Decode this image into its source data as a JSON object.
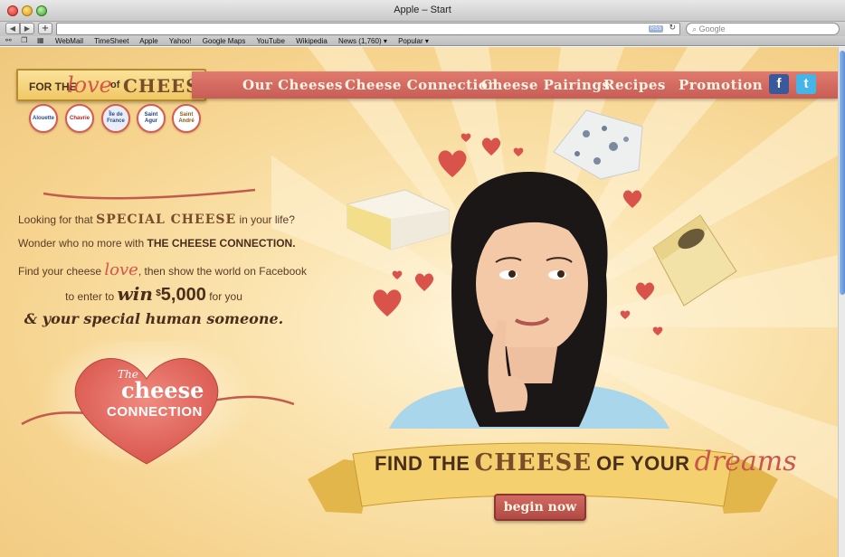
{
  "browser": {
    "window_title": "Apple – Start",
    "search_placeholder": "Google",
    "url": "",
    "rss_label": "RSS",
    "bookmarks": [
      "WebMail",
      "TimeSheet",
      "Apple",
      "Yahoo!",
      "Google Maps",
      "YouTube",
      "Wikipedia",
      "News (1,760) ▾",
      "Popular ▾"
    ]
  },
  "logo": {
    "for_the": "FOR THE",
    "love": "love",
    "of": "of",
    "cheese": "CHEESE"
  },
  "nav": {
    "items": [
      "Our Cheeses",
      "Cheese Connection",
      "Cheese Pairings",
      "Recipes",
      "Promotion"
    ],
    "social": [
      "facebook-icon",
      "twitter-icon"
    ]
  },
  "brands": [
    "Alouette",
    "Chavrie",
    "Île de France",
    "Saint Agur",
    "Saint André"
  ],
  "promo": {
    "line1_pre": "Looking for that",
    "line1_em": "SPECIAL CHEESE",
    "line1_post": "in your life?",
    "line2_pre": "Wonder who no more with",
    "line2_em": "THE CHEESE CONNECTION.",
    "line3_pre": "Find your cheese",
    "line3_em": "love",
    "line3_post": ", then show the world on Facebook",
    "line4_pre": "to enter to",
    "line4_win": "win",
    "line4_sup": "$",
    "line4_amount": "5,000",
    "line4_post": "for you",
    "line5": "& your special human someone."
  },
  "heart_badge": {
    "the": "The",
    "cheese": "cheese",
    "connection": "CONNECTION"
  },
  "banner": {
    "find_the": "FIND THE",
    "cheese": "CHEESE",
    "of_your": "OF YOUR",
    "dreams": "dreams"
  },
  "cta": {
    "label": "begin now"
  },
  "colors": {
    "ribbon": "#d06a62",
    "background": "#f6d48f",
    "heart": "#d9534a",
    "text": "#5a3a26"
  }
}
